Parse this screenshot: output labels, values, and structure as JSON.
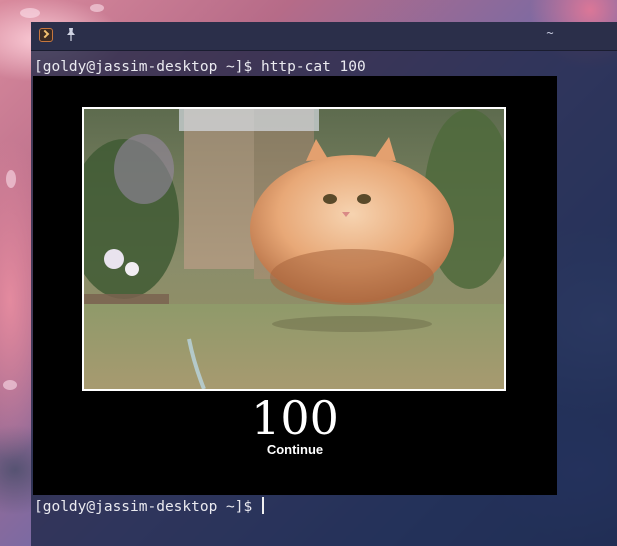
{
  "titlebar": {
    "app_icon": "terminal-icon",
    "pin_icon": "pin-icon",
    "minimize_symbol": "~"
  },
  "terminal": {
    "command_line": "[goldy@jassim-desktop ~]$ http-cat 100",
    "prompt_line": "[goldy@jassim-desktop ~]$ "
  },
  "output": {
    "code": "100",
    "status": "Continue"
  },
  "colors": {
    "terminal_text": "#eaeaf0",
    "output_background": "#000000",
    "frame_border": "#ffffff",
    "cat_fur": "#e8a877"
  }
}
